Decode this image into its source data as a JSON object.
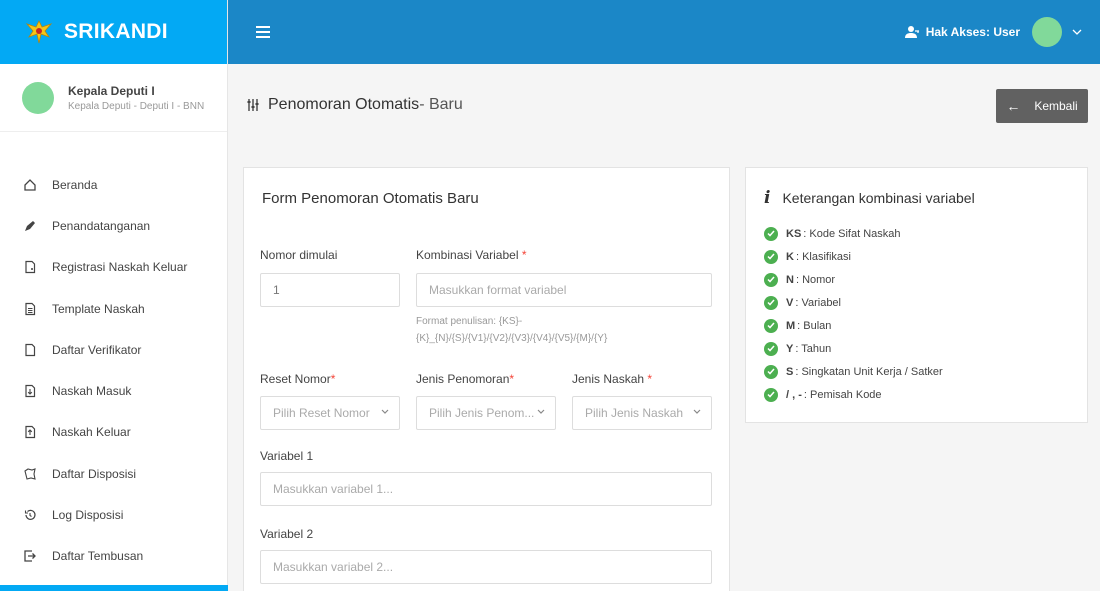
{
  "brand": {
    "name": "SRIKANDI",
    "logo_icon": "garuda-logo"
  },
  "user": {
    "name": "Kepala Deputi I",
    "role": "Kepala Deputi - Deputi I - BNN"
  },
  "sidebar": {
    "items": [
      {
        "label": "Beranda",
        "icon": "home-icon"
      },
      {
        "label": "Penandatanganan",
        "icon": "pen-icon"
      },
      {
        "label": "Registrasi Naskah Keluar",
        "icon": "document-add-icon"
      },
      {
        "label": "Template Naskah",
        "icon": "document-icon"
      },
      {
        "label": "Daftar Verifikator",
        "icon": "document-check-icon"
      },
      {
        "label": "Naskah Masuk",
        "icon": "document-in-icon"
      },
      {
        "label": "Naskah Keluar",
        "icon": "document-out-icon"
      },
      {
        "label": "Daftar Disposisi",
        "icon": "disposition-icon"
      },
      {
        "label": "Log Disposisi",
        "icon": "history-icon"
      },
      {
        "label": "Daftar Tembusan",
        "icon": "forward-icon"
      }
    ]
  },
  "topbar": {
    "access_label": "Hak Akses: User"
  },
  "page": {
    "title": "Penomoran Otomatis",
    "title_suffix": " - Baru",
    "back_label": "Kembali"
  },
  "form": {
    "title": "Form Penomoran Otomatis Baru",
    "nomor_dimulai": {
      "label": "Nomor dimulai",
      "value": "1"
    },
    "kombinasi": {
      "label": "Kombinasi Variabel",
      "placeholder": "Masukkan format variabel",
      "hint_line1": "Format penulisan: {KS}-",
      "hint_line2": "{K}_{N}/{S}/{V1}/{V2}/{V3}/{V4}/{V5}/{M}/{Y}"
    },
    "reset_nomor": {
      "label": "Reset Nomor",
      "placeholder": "Pilih Reset Nomor"
    },
    "jenis_penomoran": {
      "label": "Jenis Penomoran",
      "placeholder": "Pilih Jenis Penom..."
    },
    "jenis_naskah": {
      "label": "Jenis Naskah",
      "placeholder": "Pilih Jenis Naskah"
    },
    "variabel1": {
      "label": "Variabel 1",
      "placeholder": "Masukkan variabel 1..."
    },
    "variabel2": {
      "label": "Variabel 2",
      "placeholder": "Masukkan variabel 2..."
    },
    "required_mark": "*"
  },
  "info": {
    "title": "Keterangan kombinasi variabel",
    "items": [
      {
        "key": "KS",
        "desc": ": Kode Sifat Naskah"
      },
      {
        "key": "K",
        "desc": ": Klasifikasi"
      },
      {
        "key": "N",
        "desc": ": Nomor"
      },
      {
        "key": "V",
        "desc": ": Variabel"
      },
      {
        "key": "M",
        "desc": ": Bulan"
      },
      {
        "key": "Y",
        "desc": ": Tahun"
      },
      {
        "key": "S",
        "desc": ": Singkatan Unit Kerja / Satker"
      },
      {
        "key": "/ , -",
        "desc": ": Pemisah Kode"
      }
    ]
  },
  "colors": {
    "brand": "#03a9f4",
    "topbar": "#1b87c7",
    "success": "#4caf50",
    "required": "#f44336",
    "back_button": "#616161"
  }
}
